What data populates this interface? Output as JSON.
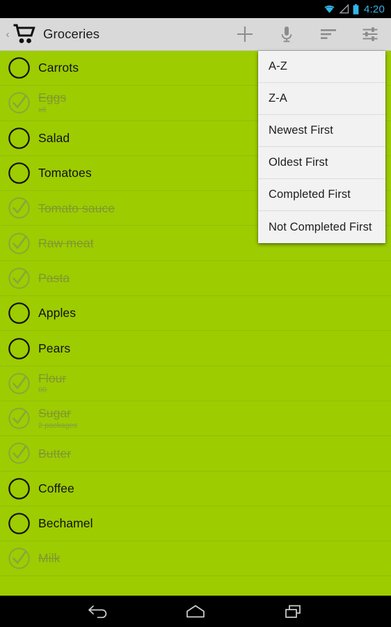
{
  "status_bar": {
    "time": "4:20",
    "icons": [
      "wifi-icon",
      "signal-icon",
      "battery-icon"
    ],
    "accent_color": "#33b5e5",
    "background": "#000000"
  },
  "action_bar": {
    "up_chevron": "‹",
    "app_icon": "shopping-cart-icon",
    "title": "Groceries",
    "background": "#d9d9d9",
    "actions": [
      {
        "name": "add-item-button",
        "icon": "plus-icon"
      },
      {
        "name": "voice-input-button",
        "icon": "microphone-icon"
      },
      {
        "name": "sort-button",
        "icon": "sort-icon"
      },
      {
        "name": "settings-button",
        "icon": "sliders-icon"
      }
    ]
  },
  "list": {
    "background": "#9dcc01",
    "items": [
      {
        "title": "Carrots",
        "subtitle": "",
        "completed": false
      },
      {
        "title": "Eggs",
        "subtitle": "x6",
        "completed": true
      },
      {
        "title": "Salad",
        "subtitle": "",
        "completed": false
      },
      {
        "title": "Tomatoes",
        "subtitle": "",
        "completed": false
      },
      {
        "title": "Tomato sauce",
        "subtitle": "",
        "completed": true
      },
      {
        "title": "Raw meat",
        "subtitle": "",
        "completed": true
      },
      {
        "title": "Pasta",
        "subtitle": "",
        "completed": true
      },
      {
        "title": "Apples",
        "subtitle": "",
        "completed": false
      },
      {
        "title": "Pears",
        "subtitle": "",
        "completed": false
      },
      {
        "title": "Flour",
        "subtitle": "00",
        "completed": true
      },
      {
        "title": "Sugar",
        "subtitle": "2 packages",
        "completed": true
      },
      {
        "title": "Butter",
        "subtitle": "",
        "completed": true
      },
      {
        "title": "Coffee",
        "subtitle": "",
        "completed": false
      },
      {
        "title": "Bechamel",
        "subtitle": "",
        "completed": false
      },
      {
        "title": "Milk",
        "subtitle": "",
        "completed": true
      }
    ]
  },
  "sort_menu": {
    "visible": true,
    "background": "#f2f2f2",
    "items": [
      {
        "label": "A-Z"
      },
      {
        "label": "Z-A"
      },
      {
        "label": "Newest First"
      },
      {
        "label": "Oldest First"
      },
      {
        "label": "Completed First"
      },
      {
        "label": "Not Completed First"
      }
    ]
  },
  "nav_bar": {
    "background": "#000000",
    "buttons": [
      {
        "name": "back-button",
        "icon": "back-arrow-icon"
      },
      {
        "name": "home-button",
        "icon": "home-icon"
      },
      {
        "name": "recents-button",
        "icon": "recents-icon"
      }
    ]
  }
}
